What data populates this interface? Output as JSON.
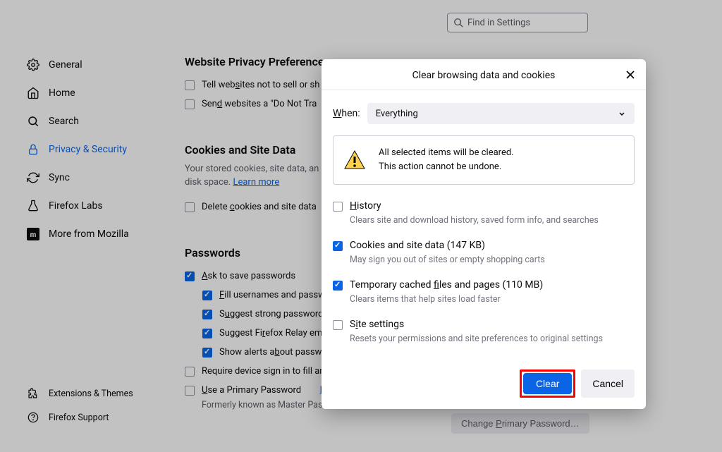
{
  "search": {
    "placeholder": "Find in Settings"
  },
  "sidebar": {
    "items": [
      {
        "label": "General"
      },
      {
        "label": "Home"
      },
      {
        "label": "Search"
      },
      {
        "label": "Privacy & Security"
      },
      {
        "label": "Sync"
      },
      {
        "label": "Firefox Labs"
      },
      {
        "label": "More from Mozilla"
      }
    ]
  },
  "bottom": {
    "extensions": "Extensions & Themes",
    "support": "Firefox Support"
  },
  "content": {
    "privacyHeading": "Website Privacy Preferences",
    "tellNotSell": "Tell websites not to sell or sh",
    "sendDoNotTrack": "Send websites a \"Do Not Tra",
    "cookiesHeading": "Cookies and Site Data",
    "cookiesSub": "Your stored cookies, site data, an",
    "cookiesSub2": "disk space.",
    "learnMore": "Learn more",
    "deleteCookies": "Delete cookies and site data",
    "passwordsHeading": "Passwords",
    "askSave": "Ask to save passwords",
    "fillUsernames": "Fill usernames and passwo",
    "suggestStrong": "Suggest strong password",
    "suggestRelay": "Suggest Firefox Relay em",
    "showAlerts": "Show alerts about passwo",
    "requireDevice": "Require device sign in to fill and manage passwords",
    "usePrimary": "Use a Primary Password",
    "learnMore2": "Learn more",
    "formerly": "Formerly known as Master Password",
    "changePrimary": "Change Primary Password…"
  },
  "modal": {
    "title": "Clear browsing data and cookies",
    "whenLabel": "When:",
    "whenValue": "Everything",
    "warning1": "All selected items will be cleared.",
    "warning2": "This action cannot be undone.",
    "history": {
      "label": "History",
      "sub": "Clears site and download history, saved form info, and searches"
    },
    "cookies": {
      "label": "Cookies and site data (147 KB)",
      "sub": "May sign you out of sites or empty shopping carts"
    },
    "cache": {
      "label": "Temporary cached files and pages (110 MB)",
      "sub": "Clears items that help sites load faster"
    },
    "siteSettings": {
      "label": "Site settings",
      "sub": "Resets your permissions and site preferences to original settings"
    },
    "clearBtn": "Clear",
    "cancelBtn": "Cancel"
  }
}
